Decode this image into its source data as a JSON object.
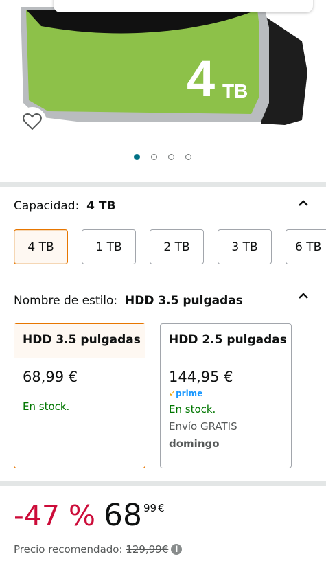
{
  "product_image": {
    "capacity_number": "4",
    "capacity_unit": "TB"
  },
  "carousel": {
    "count": 4,
    "active": 0
  },
  "capacity_section": {
    "label": "Capacidad:",
    "value": "4 TB",
    "options": [
      "4 TB",
      "1 TB",
      "2 TB",
      "3 TB",
      "6 TB"
    ],
    "selected": 0
  },
  "style_section": {
    "label": "Nombre de estilo:",
    "value": "HDD 3.5 pulgadas",
    "cards": [
      {
        "title": "HDD 3.5 pulgadas",
        "price": "68,99 €",
        "stock": "En stock."
      },
      {
        "title": "HDD 2.5 pulgadas",
        "price": "144,95 €",
        "prime": "prime",
        "stock": "En stock.",
        "shipping": "Envío GRATIS",
        "day": "domingo"
      }
    ]
  },
  "price": {
    "discount": "-47 %",
    "whole": "68",
    "fraction": "99",
    "currency": "€",
    "rrp_label": "Precio recomendado:",
    "rrp_value": "129,99€"
  },
  "colors": {
    "accent_orange": "#e77600",
    "discount_red": "#cc0c39",
    "stock_green": "#007600",
    "prime_blue": "#1a98ff",
    "drive_green": "#8dc149",
    "carousel_teal": "#007185"
  }
}
